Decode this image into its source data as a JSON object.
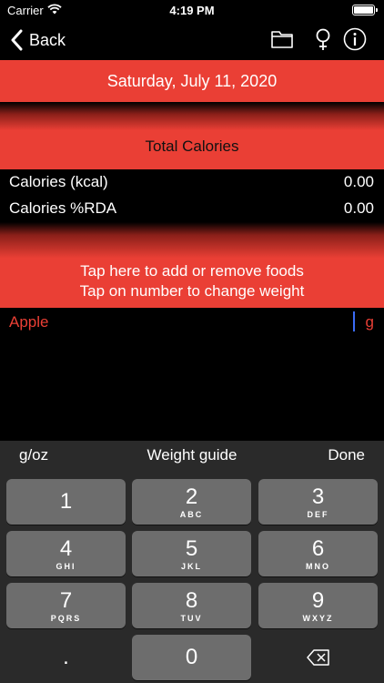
{
  "status": {
    "carrier": "Carrier",
    "time": "4:19 PM"
  },
  "nav": {
    "back_label": "Back"
  },
  "date_banner": "Saturday, July 11, 2020",
  "total_header": "Total Calories",
  "stats": [
    {
      "label": "Calories (kcal)",
      "value": "0.00"
    },
    {
      "label": "Calories %RDA",
      "value": "0.00"
    }
  ],
  "food_banner": {
    "line1": "Tap here to add or remove foods",
    "line2": "Tap on number to change weight"
  },
  "food": {
    "name": "Apple",
    "weight": "",
    "unit": "g"
  },
  "keyboard": {
    "toolbar": {
      "unit_toggle": "g/oz",
      "guide": "Weight guide",
      "done": "Done"
    },
    "keys": [
      {
        "num": "1",
        "sub": ""
      },
      {
        "num": "2",
        "sub": "ABC"
      },
      {
        "num": "3",
        "sub": "DEF"
      },
      {
        "num": "4",
        "sub": "GHI"
      },
      {
        "num": "5",
        "sub": "JKL"
      },
      {
        "num": "6",
        "sub": "MNO"
      },
      {
        "num": "7",
        "sub": "PQRS"
      },
      {
        "num": "8",
        "sub": "TUV"
      },
      {
        "num": "9",
        "sub": "WXYZ"
      },
      {
        "num": ".",
        "sub": ""
      },
      {
        "num": "0",
        "sub": ""
      }
    ]
  },
  "colors": {
    "accent": "#ea3f35",
    "caret": "#3b6cf6",
    "key": "#6d6d6d",
    "keyboard_bg": "#2a2a2a"
  }
}
